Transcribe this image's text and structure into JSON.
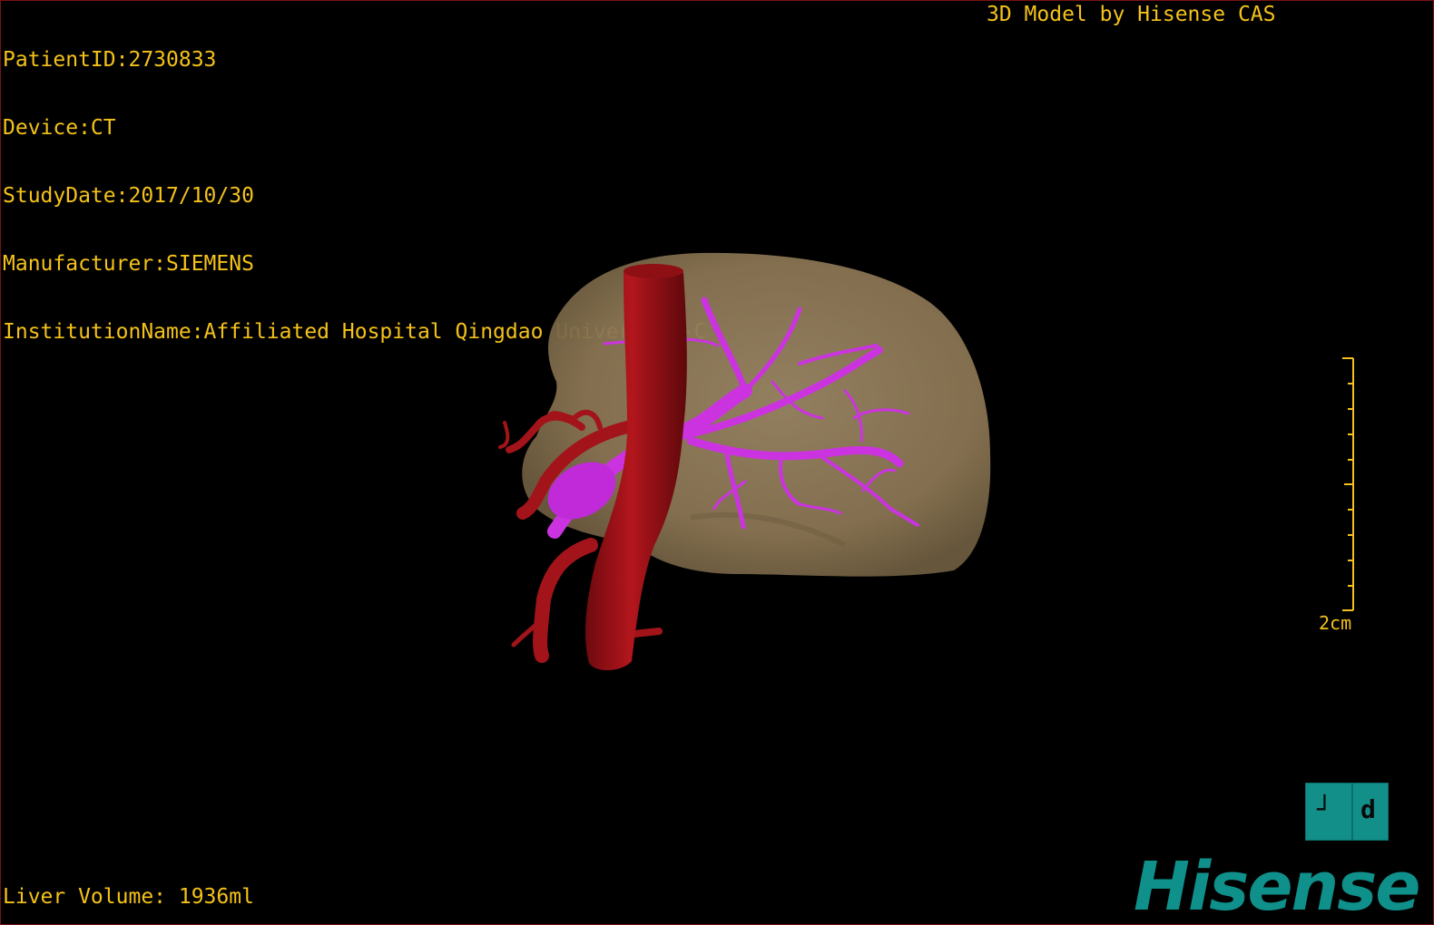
{
  "patient_info": {
    "patient_id": "PatientID:2730833",
    "device": "Device:CT",
    "study_date": "StudyDate:2017/10/30",
    "manufacturer": "Manufacturer:SIEMENS",
    "institution": "InstitutionName:Affiliated Hospital Qingdao University-C"
  },
  "credit": "3D Model by Hisense CAS",
  "liver_volume": "Liver Volume: 1936ml",
  "scale_bar": {
    "label": "2cm"
  },
  "orientation_cube": {
    "left_label": "┘",
    "right_label": "d"
  },
  "logo": {
    "text": "Hisense"
  },
  "colors": {
    "overlay_text": "#f4c21a",
    "liver": "#8e7a58",
    "artery": "#a3141a",
    "portal_vein": "#cc33e0",
    "brand": "#10908b",
    "background": "#000000"
  },
  "icons": [
    "orientation-cube-icon",
    "hisense-logo"
  ]
}
